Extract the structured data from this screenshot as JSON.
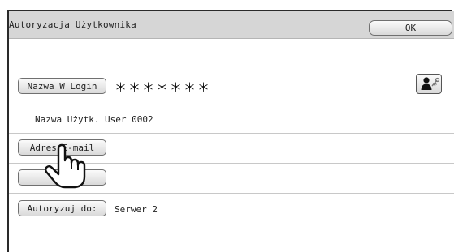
{
  "dialog": {
    "title": "Autoryzacja Użytkownika",
    "ok_label": "OK"
  },
  "login": {
    "button_label": "Nazwa W Login",
    "masked_value": "＊＊＊＊＊＊＊",
    "icon": "user-key-icon"
  },
  "user_name": {
    "label": "Nazwa Użytk.",
    "value": "User 0002"
  },
  "email": {
    "button_label": "Adres E-mail"
  },
  "password": {
    "button_label": ""
  },
  "auth": {
    "button_label": "Autoryzuj do:",
    "value": "Serwer 2"
  },
  "pointer": {
    "icon": "hand-pointer-icon"
  }
}
